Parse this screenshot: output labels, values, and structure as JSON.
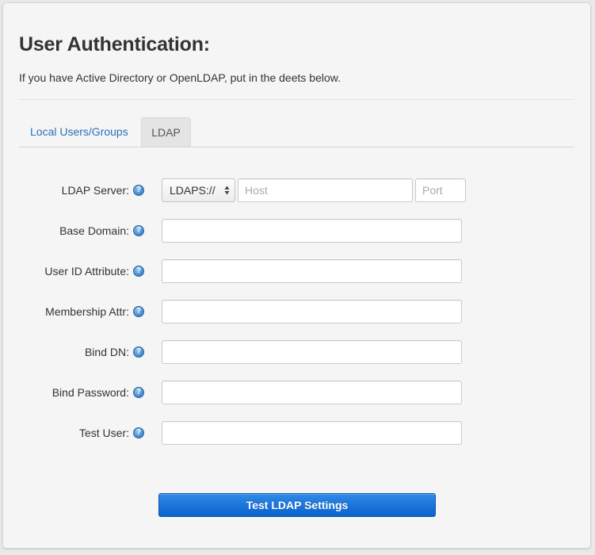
{
  "header": {
    "title": "User Authentication:",
    "subtitle": "If you have Active Directory or OpenLDAP, put in the deets below."
  },
  "tabs": [
    {
      "label": "Local Users/Groups",
      "active": false
    },
    {
      "label": "LDAP",
      "active": true
    }
  ],
  "form": {
    "server": {
      "label": "LDAP Server:",
      "protocol": "LDAPS://",
      "host_placeholder": "Host",
      "port_placeholder": "Port",
      "host_value": "",
      "port_value": ""
    },
    "fields": [
      {
        "label": "Base Domain:",
        "value": ""
      },
      {
        "label": "User ID Attribute:",
        "value": ""
      },
      {
        "label": "Membership Attr:",
        "value": ""
      },
      {
        "label": "Bind DN:",
        "value": ""
      },
      {
        "label": "Bind Password:",
        "value": ""
      },
      {
        "label": "Test User:",
        "value": ""
      }
    ],
    "help_glyph": "?",
    "submit_label": "Test LDAP Settings"
  },
  "colors": {
    "link": "#2a70b8",
    "button": "#1a74dc",
    "help_icon": "#3f86cc"
  }
}
